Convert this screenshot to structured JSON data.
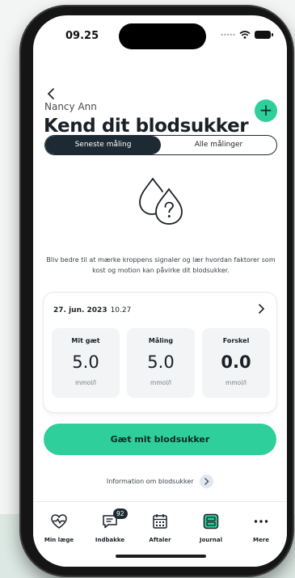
{
  "status_bar": {
    "time": "09.25"
  },
  "header": {
    "patient_name": "Nancy Ann",
    "title": "Kend dit blodsukker"
  },
  "segments": {
    "latest": "Seneste måling",
    "all": "Alle målinger"
  },
  "intro_text": "Bliv bedre til at mærke kroppens signaler og lær hvordan faktorer som kost og motion kan påvirke dit blodsukker.",
  "measurement": {
    "date": "27. jun. 2023",
    "time": "10.27",
    "metrics": [
      {
        "label": "Mit gæt",
        "value": "5.0",
        "unit": "mmol/l"
      },
      {
        "label": "Måling",
        "value": "5.0",
        "unit": "mmol/l"
      },
      {
        "label": "Forskel",
        "value": "0.0",
        "unit": "mmol/l"
      }
    ]
  },
  "cta_label": "Gæt mit blodsukker",
  "info_link": "Information om blodsukker",
  "tabbar": [
    {
      "label": "Min læge",
      "icon": "heart-pulse-icon"
    },
    {
      "label": "Indbakke",
      "icon": "chat-icon",
      "badge": "92"
    },
    {
      "label": "Aftaler",
      "icon": "calendar-icon"
    },
    {
      "label": "Journal",
      "icon": "journal-icon",
      "active": true
    },
    {
      "label": "Mere",
      "icon": "more-icon"
    }
  ],
  "colors": {
    "accent": "#2ecf9b",
    "dark": "#1e2a33",
    "background_band": "#dce8e3"
  }
}
